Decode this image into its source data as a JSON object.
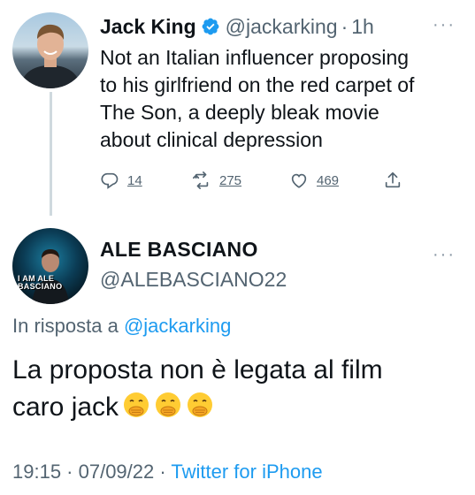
{
  "tweet": {
    "author_name": "Jack King",
    "handle": "@jackarking",
    "separator": "·",
    "time": "1h",
    "more_label": "···",
    "text": "Not an Italian influencer proposing\nto his girlfriend on the red carpet of\nThe Son, a deeply bleak movie\nabout clinical depression",
    "actions": {
      "replies": "14",
      "retweets": "275",
      "likes": "469"
    }
  },
  "reply": {
    "author_name": "ALE BASCIANO",
    "handle": "@ALEBASCIANO22",
    "avatar_text": "I AM ALE BASCIANO",
    "more_label": "···",
    "reply_prefix": "In risposta a ",
    "reply_mention": "@jackarking",
    "text": "La proposta non è legata al film\ncaro jack",
    "emoji_count": 3,
    "timestamp": "19:15 · 07/09/22 · ",
    "source": "Twitter for iPhone"
  },
  "colors": {
    "accent": "#1d9bf0",
    "text_primary": "#0f1419",
    "text_secondary": "#536471",
    "thread_line": "#cfd9de"
  }
}
